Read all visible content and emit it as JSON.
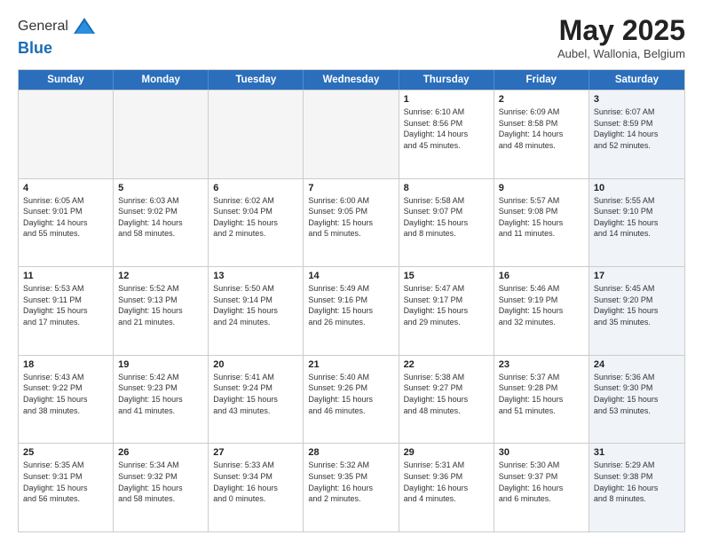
{
  "header": {
    "logo_general": "General",
    "logo_blue": "Blue",
    "month_title": "May 2025",
    "location": "Aubel, Wallonia, Belgium"
  },
  "weekdays": [
    "Sunday",
    "Monday",
    "Tuesday",
    "Wednesday",
    "Thursday",
    "Friday",
    "Saturday"
  ],
  "rows": [
    [
      {
        "day": "",
        "empty": true
      },
      {
        "day": "",
        "empty": true
      },
      {
        "day": "",
        "empty": true
      },
      {
        "day": "",
        "empty": true
      },
      {
        "day": "1",
        "lines": [
          "Sunrise: 6:10 AM",
          "Sunset: 8:56 PM",
          "Daylight: 14 hours",
          "and 45 minutes."
        ]
      },
      {
        "day": "2",
        "lines": [
          "Sunrise: 6:09 AM",
          "Sunset: 8:58 PM",
          "Daylight: 14 hours",
          "and 48 minutes."
        ]
      },
      {
        "day": "3",
        "shade": true,
        "lines": [
          "Sunrise: 6:07 AM",
          "Sunset: 8:59 PM",
          "Daylight: 14 hours",
          "and 52 minutes."
        ]
      }
    ],
    [
      {
        "day": "4",
        "lines": [
          "Sunrise: 6:05 AM",
          "Sunset: 9:01 PM",
          "Daylight: 14 hours",
          "and 55 minutes."
        ]
      },
      {
        "day": "5",
        "lines": [
          "Sunrise: 6:03 AM",
          "Sunset: 9:02 PM",
          "Daylight: 14 hours",
          "and 58 minutes."
        ]
      },
      {
        "day": "6",
        "lines": [
          "Sunrise: 6:02 AM",
          "Sunset: 9:04 PM",
          "Daylight: 15 hours",
          "and 2 minutes."
        ]
      },
      {
        "day": "7",
        "lines": [
          "Sunrise: 6:00 AM",
          "Sunset: 9:05 PM",
          "Daylight: 15 hours",
          "and 5 minutes."
        ]
      },
      {
        "day": "8",
        "lines": [
          "Sunrise: 5:58 AM",
          "Sunset: 9:07 PM",
          "Daylight: 15 hours",
          "and 8 minutes."
        ]
      },
      {
        "day": "9",
        "lines": [
          "Sunrise: 5:57 AM",
          "Sunset: 9:08 PM",
          "Daylight: 15 hours",
          "and 11 minutes."
        ]
      },
      {
        "day": "10",
        "shade": true,
        "lines": [
          "Sunrise: 5:55 AM",
          "Sunset: 9:10 PM",
          "Daylight: 15 hours",
          "and 14 minutes."
        ]
      }
    ],
    [
      {
        "day": "11",
        "lines": [
          "Sunrise: 5:53 AM",
          "Sunset: 9:11 PM",
          "Daylight: 15 hours",
          "and 17 minutes."
        ]
      },
      {
        "day": "12",
        "lines": [
          "Sunrise: 5:52 AM",
          "Sunset: 9:13 PM",
          "Daylight: 15 hours",
          "and 21 minutes."
        ]
      },
      {
        "day": "13",
        "lines": [
          "Sunrise: 5:50 AM",
          "Sunset: 9:14 PM",
          "Daylight: 15 hours",
          "and 24 minutes."
        ]
      },
      {
        "day": "14",
        "lines": [
          "Sunrise: 5:49 AM",
          "Sunset: 9:16 PM",
          "Daylight: 15 hours",
          "and 26 minutes."
        ]
      },
      {
        "day": "15",
        "lines": [
          "Sunrise: 5:47 AM",
          "Sunset: 9:17 PM",
          "Daylight: 15 hours",
          "and 29 minutes."
        ]
      },
      {
        "day": "16",
        "lines": [
          "Sunrise: 5:46 AM",
          "Sunset: 9:19 PM",
          "Daylight: 15 hours",
          "and 32 minutes."
        ]
      },
      {
        "day": "17",
        "shade": true,
        "lines": [
          "Sunrise: 5:45 AM",
          "Sunset: 9:20 PM",
          "Daylight: 15 hours",
          "and 35 minutes."
        ]
      }
    ],
    [
      {
        "day": "18",
        "lines": [
          "Sunrise: 5:43 AM",
          "Sunset: 9:22 PM",
          "Daylight: 15 hours",
          "and 38 minutes."
        ]
      },
      {
        "day": "19",
        "lines": [
          "Sunrise: 5:42 AM",
          "Sunset: 9:23 PM",
          "Daylight: 15 hours",
          "and 41 minutes."
        ]
      },
      {
        "day": "20",
        "lines": [
          "Sunrise: 5:41 AM",
          "Sunset: 9:24 PM",
          "Daylight: 15 hours",
          "and 43 minutes."
        ]
      },
      {
        "day": "21",
        "lines": [
          "Sunrise: 5:40 AM",
          "Sunset: 9:26 PM",
          "Daylight: 15 hours",
          "and 46 minutes."
        ]
      },
      {
        "day": "22",
        "lines": [
          "Sunrise: 5:38 AM",
          "Sunset: 9:27 PM",
          "Daylight: 15 hours",
          "and 48 minutes."
        ]
      },
      {
        "day": "23",
        "lines": [
          "Sunrise: 5:37 AM",
          "Sunset: 9:28 PM",
          "Daylight: 15 hours",
          "and 51 minutes."
        ]
      },
      {
        "day": "24",
        "shade": true,
        "lines": [
          "Sunrise: 5:36 AM",
          "Sunset: 9:30 PM",
          "Daylight: 15 hours",
          "and 53 minutes."
        ]
      }
    ],
    [
      {
        "day": "25",
        "lines": [
          "Sunrise: 5:35 AM",
          "Sunset: 9:31 PM",
          "Daylight: 15 hours",
          "and 56 minutes."
        ]
      },
      {
        "day": "26",
        "lines": [
          "Sunrise: 5:34 AM",
          "Sunset: 9:32 PM",
          "Daylight: 15 hours",
          "and 58 minutes."
        ]
      },
      {
        "day": "27",
        "lines": [
          "Sunrise: 5:33 AM",
          "Sunset: 9:34 PM",
          "Daylight: 16 hours",
          "and 0 minutes."
        ]
      },
      {
        "day": "28",
        "lines": [
          "Sunrise: 5:32 AM",
          "Sunset: 9:35 PM",
          "Daylight: 16 hours",
          "and 2 minutes."
        ]
      },
      {
        "day": "29",
        "lines": [
          "Sunrise: 5:31 AM",
          "Sunset: 9:36 PM",
          "Daylight: 16 hours",
          "and 4 minutes."
        ]
      },
      {
        "day": "30",
        "lines": [
          "Sunrise: 5:30 AM",
          "Sunset: 9:37 PM",
          "Daylight: 16 hours",
          "and 6 minutes."
        ]
      },
      {
        "day": "31",
        "shade": true,
        "lines": [
          "Sunrise: 5:29 AM",
          "Sunset: 9:38 PM",
          "Daylight: 16 hours",
          "and 8 minutes."
        ]
      }
    ]
  ]
}
